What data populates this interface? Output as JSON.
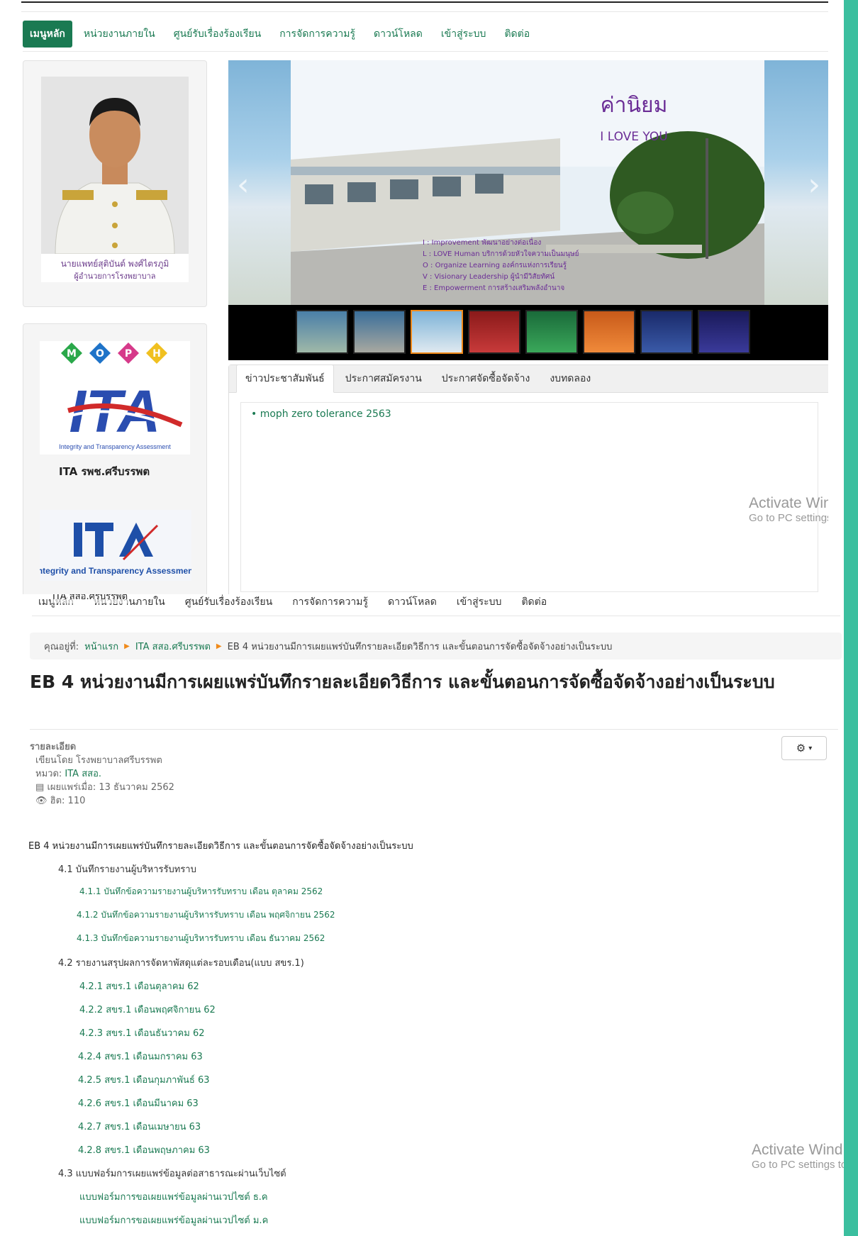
{
  "nav": {
    "items": [
      "เมนูหลัก",
      "หน่วยงานภายใน",
      "ศูนย์รับเรื่องร้องเรียน",
      "การจัดการความรู้",
      "ดาวน์โหลด",
      "เข้าสู่ระบบ",
      "ติดต่อ"
    ]
  },
  "director": {
    "name": "นายแพทย์สุติบันต์ พงศ์ไตรภูมิ",
    "title": "ผู้อำนวยการโรงพยาบาล"
  },
  "logos": {
    "moph_letters": [
      "M",
      "O",
      "P",
      "H"
    ],
    "ita1_wordmark": "ITA",
    "ita1_tagline": "Integrity and Transparency Assessment",
    "ita1_label": "ITA รพช.ศรีบรรพต",
    "ita2_tagline": "Integrity and Transparency Assessment"
  },
  "slider": {
    "title": "ค่านิยม",
    "subtitle": "I LOVE YOU",
    "values": [
      "I : Improvement พัฒนาอย่างต่อเนื่อง",
      "L : LOVE Human บริการด้วยหัวใจความเป็นมนุษย์",
      "O : Organize Learning องค์กรแห่งการเรียนรู้",
      "V : Visionary Leadership ผู้นำมีวิสัยทัศน์",
      "E : Empowerment การสร้างเสริมพลังอำนาจ"
    ],
    "prev_icon": "chevron-left-icon",
    "next_icon": "chevron-right-icon",
    "thumbnail_count": 8,
    "active_thumbnail": 3
  },
  "news_tabs": {
    "tabs": [
      "ข่าวประชาสัมพันธ์",
      "ประกาศสมัครงาน",
      "ประกาศจัดซื้อจัดจ้าง",
      "งบทดลอง"
    ],
    "active": 0,
    "items": [
      "moph zero tolerance 2563"
    ]
  },
  "watermark": {
    "line1": "Activate Wind",
    "line2": "Go to PC settings to"
  },
  "nav2": {
    "items": [
      "เมนูหลัก",
      "หน่วยงานภายใน",
      "ศูนย์รับเรื่องร้องเรียน",
      "การจัดการความรู้",
      "ดาวน์โหลด",
      "เข้าสู่ระบบ",
      "ติดต่อ"
    ],
    "overlap_text": "ITA สสอ.ศรีบรรพต"
  },
  "breadcrumb": {
    "label": "คุณอยู่ที่:",
    "items": [
      "หน้าแรก",
      "ITA สสอ.ศรีบรรพต"
    ],
    "current": "EB 4 หน่วยงานมีการเผยแพร่บันทึกรายละเอียดวิธีการ และขั้นตอนการจัดซื้อจัดจ้างอย่างเป็นระบบ"
  },
  "article": {
    "title": "EB 4 หน่วยงานมีการเผยแพร่บันทึกรายละเอียดวิธีการ และขั้นตอนการจัดซื้อจัดจ้างอย่างเป็นระบบ",
    "meta": {
      "details_label": "รายละเอียด",
      "author": "เขียนโดย โรงพยาบาลศรีบรรพต",
      "category_label": "หมวด:",
      "category": "ITA สสอ.",
      "published": "เผยแพร่เมื่อ: 13 ธันวาคม 2562",
      "hits": "ฮิต: 110"
    },
    "outline": {
      "heading": "EB 4  หน่วยงานมีการเผยแพร่บันทึกรายละเอียดวิธีการ และขั้นตอนการจัดซื้อจัดจ้างอย่างเป็นระบบ",
      "s41": "4.1 บันทึกรายงานผู้บริหารรับทราบ",
      "s41_items": [
        "4.1.1 บันทึกข้อความรายงานผู้บริหารรับทราบ เดือน ตุลาคม 2562",
        "4.1.2 บันทึกข้อความรายงานผู้บริหารรับทราบ เดือน พฤศจิกายน 2562",
        "4.1.3 บันทึกข้อความรายงานผู้บริหารรับทราบ เดือน ธันวาคม 2562"
      ],
      "s42": "4.2 รายงานสรุปผลการจัดหาพัสดุแต่ละรอบเดือน(แบบ สขร.1)",
      "s42_items": [
        "4.2.1 สขร.1 เดือนตุลาคม 62",
        "4.2.2 สขร.1 เดือนพฤศจิกายน 62",
        "4.2.3  สขร.1 เดือนธันวาคม 62",
        "4.2.4 สขร.1 เดือนมกราคม 63",
        "4.2.5 สขร.1 เดือนกุมภาพันธ์ 63",
        "4.2.6 สขร.1 เดือนมีนาคม 63",
        "4.2.7 สขร.1 เดือนเมษายน 63",
        "4.2.8 สขร.1 เดือนพฤษภาคม 63"
      ],
      "s43": "4.3  แบบฟอร์มการเผยแพร่ข้อมูลต่อสาธารณะผ่านเว็บไซต์",
      "s43_items": [
        "แบบฟอร์มการขอเผยแพร่ข้อมูลผ่านเวปไซต์ ธ.ค",
        "แบบฟอร์มการขอเผยแพร่ข้อมูลผ่านเวปไซต์ ม.ค"
      ]
    }
  },
  "colors": {
    "brand_green": "#1a7a52",
    "teal_bar": "#3bbf9f",
    "accent_orange": "#f08a1a",
    "slider_purple": "#6b2d96"
  }
}
